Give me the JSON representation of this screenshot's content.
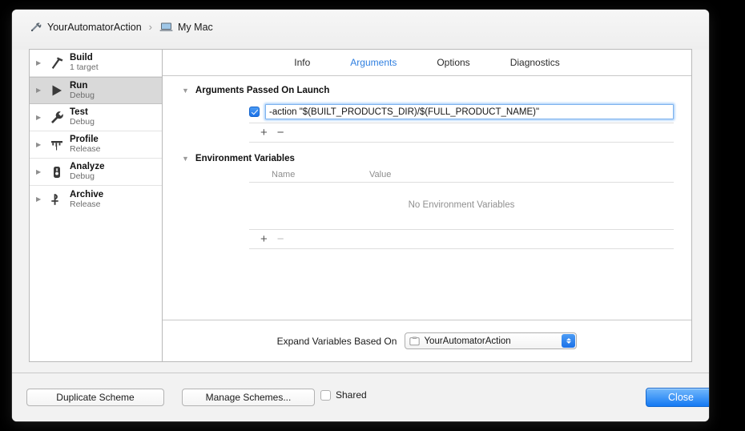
{
  "window": {
    "breadcrumb": {
      "scheme_icon": "automator-icon",
      "scheme_name": "YourAutomatorAction",
      "separator": "›",
      "destination_icon": "mac-laptop-icon",
      "destination_name": "My Mac"
    }
  },
  "sidebar": {
    "items": [
      {
        "title": "Build",
        "subtitle": "1 target",
        "icon": "hammer-icon",
        "selected": false
      },
      {
        "title": "Run",
        "subtitle": "Debug",
        "icon": "play-icon",
        "selected": true
      },
      {
        "title": "Test",
        "subtitle": "Debug",
        "icon": "wrench-icon",
        "selected": false
      },
      {
        "title": "Profile",
        "subtitle": "Release",
        "icon": "gauge-icon",
        "selected": false
      },
      {
        "title": "Analyze",
        "subtitle": "Debug",
        "icon": "microscope-icon",
        "selected": false
      },
      {
        "title": "Archive",
        "subtitle": "Release",
        "icon": "archive-icon",
        "selected": false
      }
    ]
  },
  "tabs": [
    {
      "label": "Info",
      "active": false
    },
    {
      "label": "Arguments",
      "active": true
    },
    {
      "label": "Options",
      "active": false
    },
    {
      "label": "Diagnostics",
      "active": false
    }
  ],
  "arguments_section": {
    "title": "Arguments Passed On Launch",
    "disclosure": "▼",
    "rows": [
      {
        "checked": true,
        "value": "-action \"$(BUILT_PRODUCTS_DIR)/$(FULL_PRODUCT_NAME)\"",
        "focused": true
      }
    ],
    "add_label": "+",
    "remove_label": "−",
    "remove_enabled": true
  },
  "environment_section": {
    "title": "Environment Variables",
    "disclosure": "▼",
    "columns": {
      "name": "Name",
      "value": "Value"
    },
    "rows": [],
    "empty_message": "No Environment Variables",
    "add_label": "+",
    "remove_label": "−",
    "remove_enabled": false
  },
  "expand_variables": {
    "label": "Expand Variables Based On",
    "selected_value": "YourAutomatorAction",
    "icon": "target-folder-icon"
  },
  "bottom_bar": {
    "duplicate_scheme": "Duplicate Scheme",
    "manage_schemes": "Manage Schemes...",
    "shared_label": "Shared",
    "shared_checked": false,
    "close": "Close"
  },
  "colors": {
    "accent_blue": "#2f7fe0",
    "default_button_blue": "#1479f3",
    "checkbox_blue": "#1b71e8",
    "selected_row_gray": "#d9d9d9",
    "window_chrome": "#f2f2f2"
  }
}
